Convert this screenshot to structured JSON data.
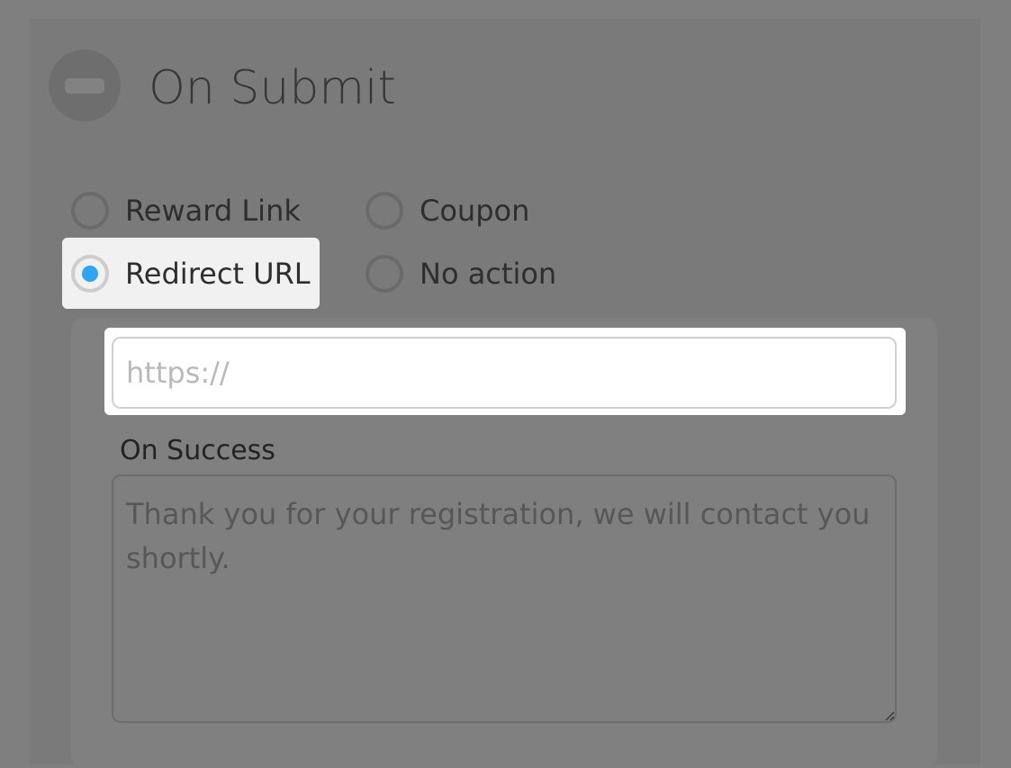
{
  "section": {
    "title": "On Submit",
    "toggle_icon": "minus-circle-icon"
  },
  "options": [
    {
      "label": "Reward Link",
      "selected": false
    },
    {
      "label": "Coupon",
      "selected": false
    },
    {
      "label": "Redirect URL",
      "selected": true
    },
    {
      "label": "No action",
      "selected": false
    }
  ],
  "redirect": {
    "placeholder": "https://",
    "value": ""
  },
  "on_success": {
    "label": "On Success",
    "placeholder": "Thank you for your registration, we will contact you shortly."
  },
  "colors": {
    "accent": "#2fa4f5",
    "overlay": "#7f7f7f",
    "highlight": "#f1f1f1"
  }
}
